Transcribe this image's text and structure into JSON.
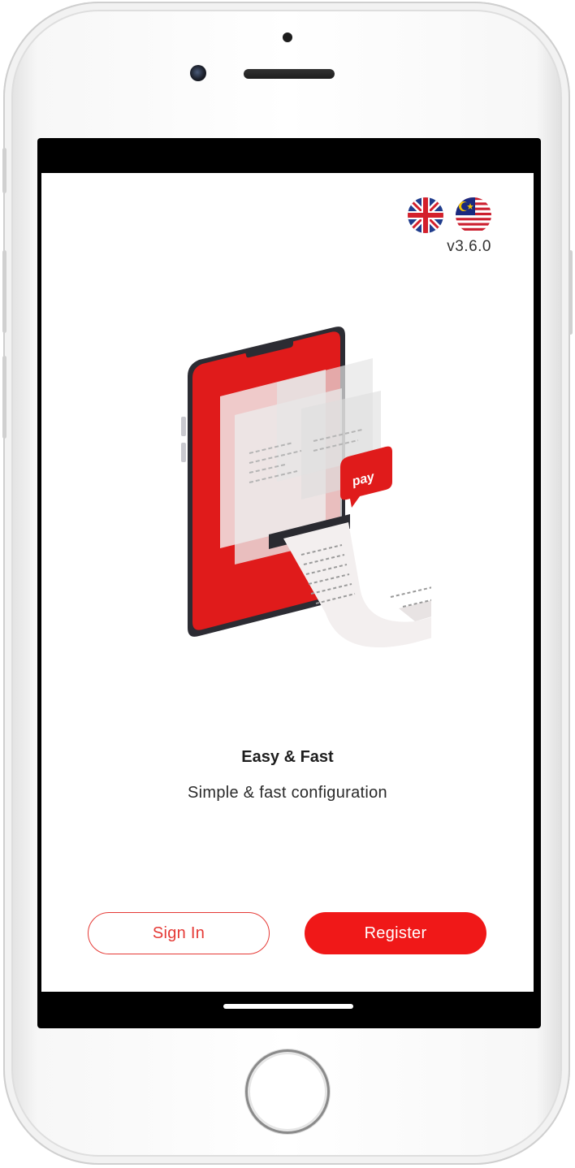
{
  "header": {
    "version": "v3.6.0",
    "languages": [
      {
        "icon": "uk-flag-icon",
        "code": "en"
      },
      {
        "icon": "malaysia-flag-icon",
        "code": "ms"
      }
    ]
  },
  "hero": {
    "illustration": "phone-receipt-illustration",
    "badge_text": "pay"
  },
  "onboarding": {
    "title": "Easy & Fast",
    "subtitle": "Simple & fast configuration"
  },
  "actions": {
    "sign_in_label": "Sign In",
    "register_label": "Register"
  },
  "colors": {
    "brand_red": "#f01818",
    "outline_red": "#e53935"
  }
}
